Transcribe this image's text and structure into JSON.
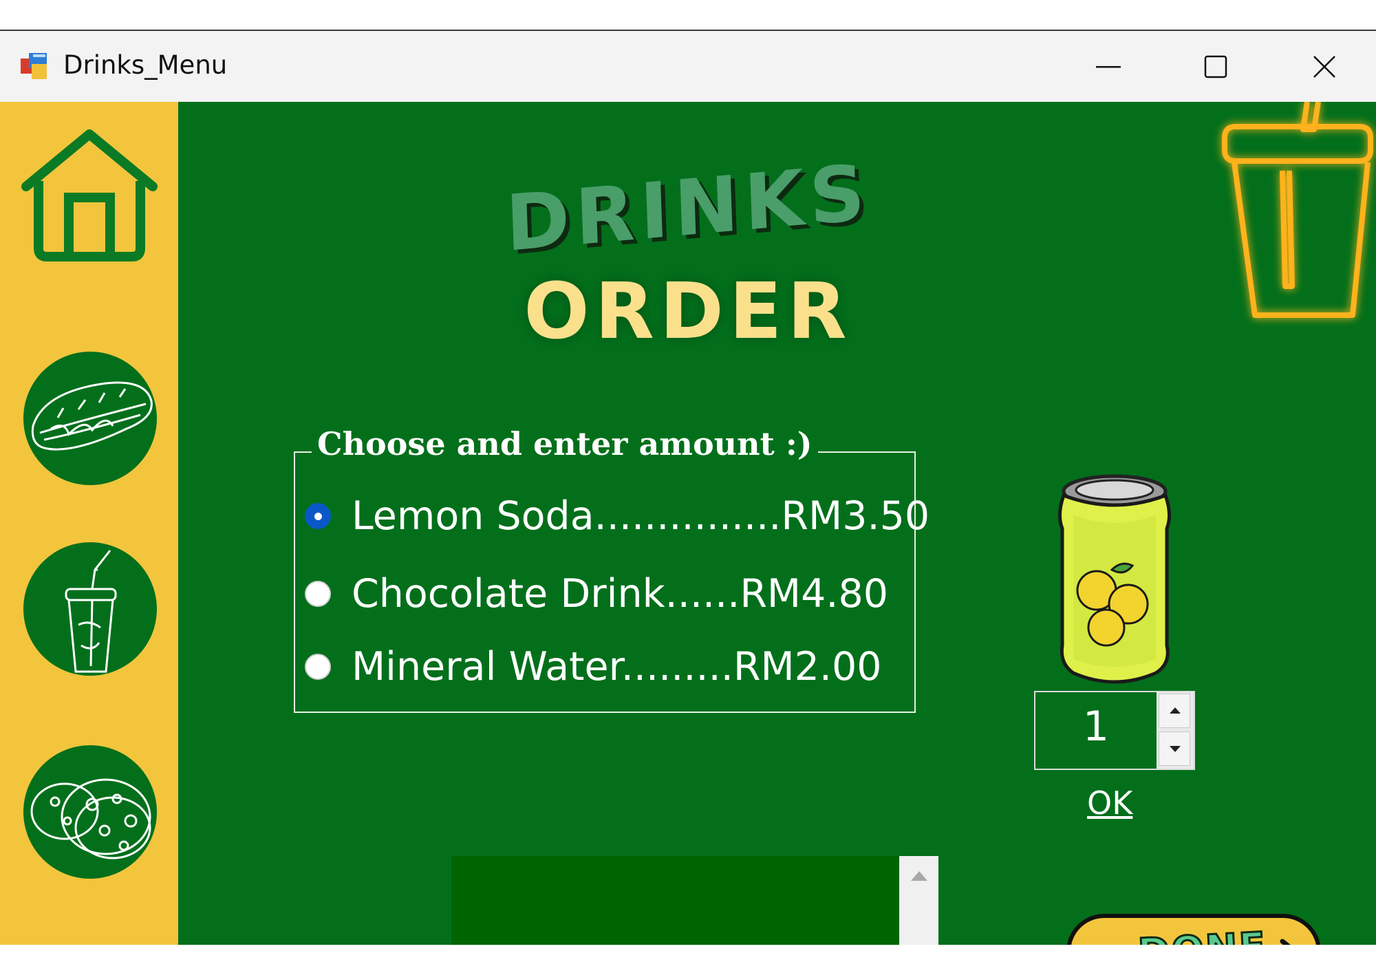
{
  "window": {
    "title": "Drinks_Menu",
    "icons": {
      "app": "winforms-app-icon",
      "minimize": "minimize-icon",
      "maximize": "maximize-icon",
      "close": "close-icon"
    }
  },
  "sidebar": {
    "items": [
      {
        "icon": "home-icon"
      },
      {
        "icon": "sandwich-icon"
      },
      {
        "icon": "drink-cup-icon"
      },
      {
        "icon": "cookies-icon"
      }
    ],
    "colors": {
      "background": "#f2c53d",
      "circle": "#036f1b"
    }
  },
  "heading": {
    "line1": "DRINKS",
    "line2": "ORDER"
  },
  "choices": {
    "legend": "Choose and enter amount :)",
    "options": [
      {
        "label": "Lemon Soda...............RM3.50",
        "checked": true
      },
      {
        "label": "Chocolate Drink......RM4.80",
        "checked": false
      },
      {
        "label": "Mineral Water.........RM2.00",
        "checked": false
      }
    ]
  },
  "quantity": {
    "value": "1"
  },
  "ok_link": {
    "label": "OK"
  },
  "done_button": {
    "label": "DONE",
    "icon": "chevron-right-icon"
  },
  "decor": {
    "neon_cup": "neon-cup-icon",
    "soda_can": "lemon-soda-can-image"
  },
  "colors": {
    "background": "#036f1b",
    "accent": "#f2c53d",
    "heading1": "#4a9e6a",
    "heading2": "#fbe08c",
    "radio_checked": "#0a58c8"
  }
}
